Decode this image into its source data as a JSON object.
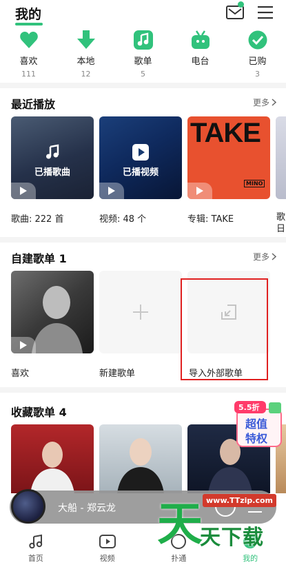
{
  "header": {
    "title": "我的"
  },
  "quick": [
    {
      "label": "喜欢",
      "count": "111",
      "icon": "heart-icon"
    },
    {
      "label": "本地",
      "count": "12",
      "icon": "download-icon"
    },
    {
      "label": "歌单",
      "count": "5",
      "icon": "music-note-icon"
    },
    {
      "label": "电台",
      "count": "",
      "icon": "radio-icon"
    },
    {
      "label": "已购",
      "count": "3",
      "icon": "check-icon"
    }
  ],
  "recent": {
    "title": "最近播放",
    "more": "更多",
    "cards": [
      {
        "overlay": "已播歌曲",
        "label": "歌曲: 222 首"
      },
      {
        "overlay": "已播视频",
        "label": "视频: 48 个"
      },
      {
        "cover_text": "TAKE",
        "cover_sub": "MINO",
        "label": "专辑: TAKE"
      },
      {
        "label": "歌\n日"
      }
    ]
  },
  "custom": {
    "title": "自建歌单 1",
    "more": "更多",
    "cards": [
      {
        "label": "喜欢"
      },
      {
        "label": "新建歌单"
      },
      {
        "label": "导入外部歌单"
      }
    ]
  },
  "collected": {
    "title": "收藏歌单 4"
  },
  "promo": {
    "top": "5.5折",
    "line1": "超值",
    "line2": "特权"
  },
  "player": {
    "title": "大船 - 郑云龙"
  },
  "nav": [
    {
      "label": "首页",
      "icon": "music-note-icon"
    },
    {
      "label": "视频",
      "icon": "video-icon"
    },
    {
      "label": "扑通",
      "icon": "heart-beat-icon"
    },
    {
      "label": "我的",
      "icon": "profile-icon"
    }
  ],
  "watermark": {
    "url": "www.TTzip.com",
    "big": "天",
    "text": "天下载"
  },
  "colors": {
    "accent": "#31c27c",
    "highlight_border": "#e02020"
  }
}
